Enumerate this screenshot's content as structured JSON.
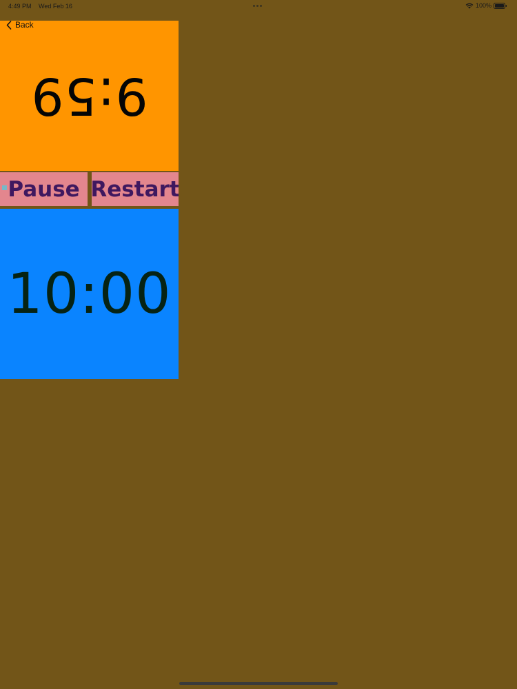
{
  "status_bar": {
    "time": "4:49 PM",
    "date": "Wed Feb 16",
    "battery": "100%",
    "icons": [
      "multitasking-dots-icon",
      "wifi-icon",
      "battery-icon"
    ]
  },
  "navigation": {
    "back_label": "Back",
    "back_icon": "chevron-left-icon"
  },
  "timers": {
    "top": {
      "time": "9:59",
      "orientation": "upside-down",
      "color": "#ff9500"
    },
    "bottom": {
      "time": "10:00",
      "orientation": "upright",
      "color": "#0a84ff"
    }
  },
  "controls": {
    "pause_label": "Pause",
    "restart_label": "Restart",
    "button_color": "#e3868e",
    "text_color": "#3f185f"
  },
  "colors": {
    "background": "#725518"
  }
}
